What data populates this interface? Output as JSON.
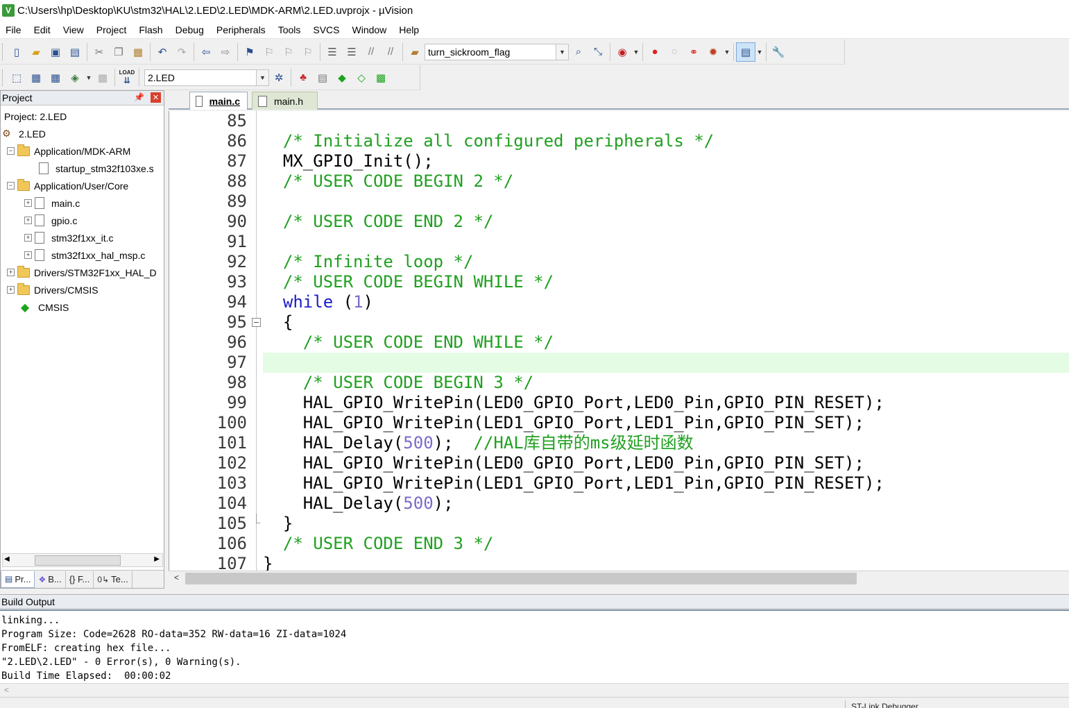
{
  "window": {
    "title": "C:\\Users\\hp\\Desktop\\KU\\stm32\\HAL\\2.LED\\2.LED\\MDK-ARM\\2.LED.uvprojx - µVision"
  },
  "menu": [
    "File",
    "Edit",
    "View",
    "Project",
    "Flash",
    "Debug",
    "Peripherals",
    "Tools",
    "SVCS",
    "Window",
    "Help"
  ],
  "toolbar": {
    "find_combo_value": "turn_sickroom_flag",
    "target_combo_value": "2.LED",
    "load_label": "LOAD"
  },
  "project_panel": {
    "title": "Project",
    "project_label": "Project: 2.LED",
    "target": "2.LED",
    "tree": [
      {
        "label": "Application/MDK-ARM"
      },
      {
        "label": "startup_stm32f103xe.s"
      },
      {
        "label": "Application/User/Core"
      },
      {
        "label": "main.c"
      },
      {
        "label": "gpio.c"
      },
      {
        "label": "stm32f1xx_it.c"
      },
      {
        "label": "stm32f1xx_hal_msp.c"
      },
      {
        "label": "Drivers/STM32F1xx_HAL_D"
      },
      {
        "label": "Drivers/CMSIS"
      },
      {
        "label": "CMSIS"
      }
    ],
    "tabs": [
      "Pr...",
      "B...",
      "{} F...",
      "Te..."
    ]
  },
  "editor": {
    "tabs": [
      {
        "label": "main.c",
        "active": true
      },
      {
        "label": "main.h",
        "active": false
      }
    ],
    "highlight_line": "97",
    "lines": [
      {
        "num": "85",
        "indent": "",
        "parts": []
      },
      {
        "num": "86",
        "indent": "  ",
        "parts": [
          {
            "t": "/* Initialize all configured peripherals */",
            "c": "cmt"
          }
        ]
      },
      {
        "num": "87",
        "indent": "  ",
        "parts": [
          {
            "t": "MX_GPIO_Init();",
            "c": "plain"
          }
        ]
      },
      {
        "num": "88",
        "indent": "  ",
        "parts": [
          {
            "t": "/* USER CODE BEGIN 2 */",
            "c": "cmt"
          }
        ]
      },
      {
        "num": "89",
        "indent": "",
        "parts": []
      },
      {
        "num": "90",
        "indent": "  ",
        "parts": [
          {
            "t": "/* USER CODE END 2 */",
            "c": "cmt"
          }
        ]
      },
      {
        "num": "91",
        "indent": "",
        "parts": []
      },
      {
        "num": "92",
        "indent": "  ",
        "parts": [
          {
            "t": "/* Infinite loop */",
            "c": "cmt"
          }
        ]
      },
      {
        "num": "93",
        "indent": "  ",
        "parts": [
          {
            "t": "/* USER CODE BEGIN WHILE */",
            "c": "cmt"
          }
        ]
      },
      {
        "num": "94",
        "indent": "  ",
        "parts": [
          {
            "t": "while",
            "c": "kw"
          },
          {
            "t": " (",
            "c": "plain"
          },
          {
            "t": "1",
            "c": "num"
          },
          {
            "t": ")",
            "c": "plain"
          }
        ]
      },
      {
        "num": "95",
        "indent": "  ",
        "parts": [
          {
            "t": "{",
            "c": "plain"
          }
        ]
      },
      {
        "num": "96",
        "indent": "    ",
        "parts": [
          {
            "t": "/* USER CODE END WHILE */",
            "c": "cmt"
          }
        ]
      },
      {
        "num": "97",
        "indent": "",
        "parts": []
      },
      {
        "num": "98",
        "indent": "    ",
        "parts": [
          {
            "t": "/* USER CODE BEGIN 3 */",
            "c": "cmt"
          }
        ]
      },
      {
        "num": "99",
        "indent": "    ",
        "parts": [
          {
            "t": "HAL_GPIO_WritePin(LED0_GPIO_Port,LED0_Pin,GPIO_PIN_RESET);",
            "c": "plain"
          }
        ]
      },
      {
        "num": "100",
        "indent": "    ",
        "parts": [
          {
            "t": "HAL_GPIO_WritePin(LED1_GPIO_Port,LED1_Pin,GPIO_PIN_SET);",
            "c": "plain"
          }
        ]
      },
      {
        "num": "101",
        "indent": "    ",
        "parts": [
          {
            "t": "HAL_Delay(",
            "c": "plain"
          },
          {
            "t": "500",
            "c": "num"
          },
          {
            "t": ");  ",
            "c": "plain"
          },
          {
            "t": "//HAL库自带的ms级延时函数",
            "c": "cmt"
          }
        ]
      },
      {
        "num": "102",
        "indent": "    ",
        "parts": [
          {
            "t": "HAL_GPIO_WritePin(LED0_GPIO_Port,LED0_Pin,GPIO_PIN_SET);",
            "c": "plain"
          }
        ]
      },
      {
        "num": "103",
        "indent": "    ",
        "parts": [
          {
            "t": "HAL_GPIO_WritePin(LED1_GPIO_Port,LED1_Pin,GPIO_PIN_RESET);",
            "c": "plain"
          }
        ]
      },
      {
        "num": "104",
        "indent": "    ",
        "parts": [
          {
            "t": "HAL_Delay(",
            "c": "plain"
          },
          {
            "t": "500",
            "c": "num"
          },
          {
            "t": ");",
            "c": "plain"
          }
        ]
      },
      {
        "num": "105",
        "indent": "  ",
        "parts": [
          {
            "t": "}",
            "c": "plain"
          }
        ]
      },
      {
        "num": "106",
        "indent": "  ",
        "parts": [
          {
            "t": "/* USER CODE END 3 */",
            "c": "cmt"
          }
        ]
      },
      {
        "num": "107",
        "indent": "",
        "parts": [
          {
            "t": "}",
            "c": "plain"
          }
        ]
      }
    ]
  },
  "build_output": {
    "title": "Build Output",
    "lines": [
      "linking...",
      "Program Size: Code=2628 RO-data=352 RW-data=16 ZI-data=1024",
      "FromELF: creating hex file...",
      "\"2.LED\\2.LED\" - 0 Error(s), 0 Warning(s).",
      "Build Time Elapsed:  00:00:02"
    ]
  },
  "status": {
    "debugger": "ST-Link Debugger"
  },
  "colors": {
    "comment": "#20a020",
    "keyword": "#1c1cc8",
    "number": "#7a6acb",
    "current_line": "#e4fbe4"
  }
}
